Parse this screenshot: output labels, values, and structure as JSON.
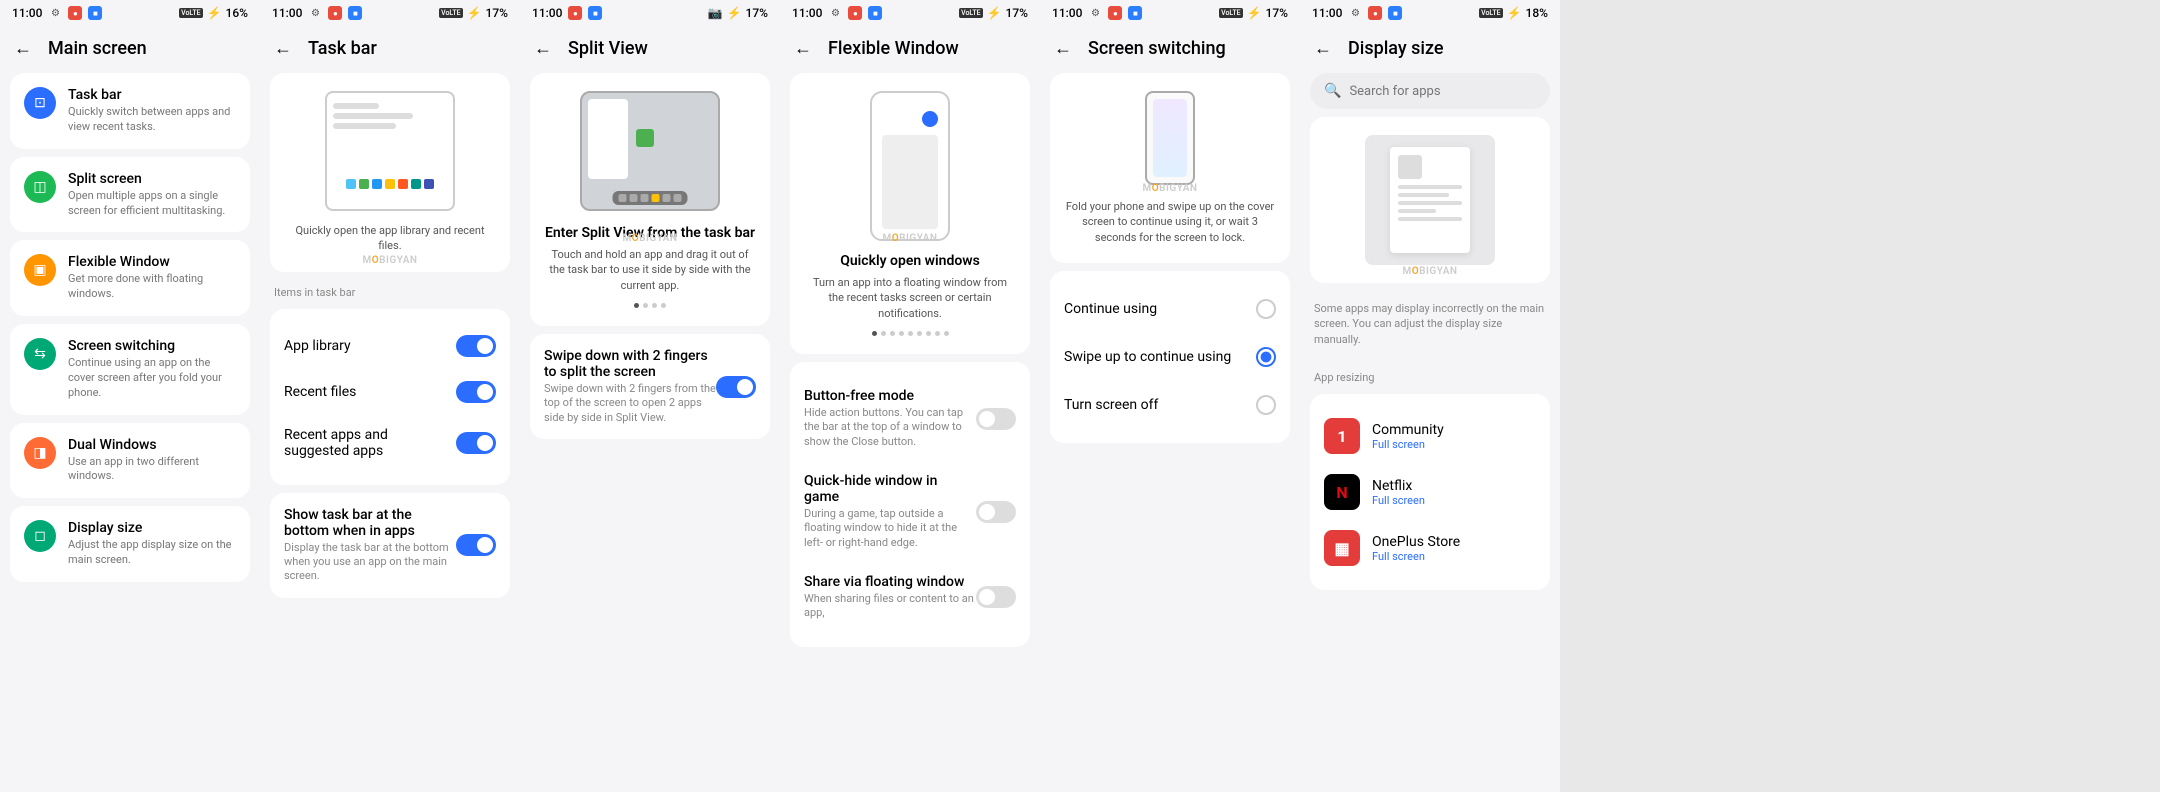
{
  "status": {
    "time": "11:00",
    "battery1": "16%",
    "battery2": "17%",
    "battery3": "18%"
  },
  "watermark": "MOBIGYAN",
  "s1": {
    "title": "Main screen",
    "items": [
      {
        "title": "Task bar",
        "desc": "Quickly switch between apps and view recent tasks."
      },
      {
        "title": "Split screen",
        "desc": "Open multiple apps on a single screen for efficient multitasking."
      },
      {
        "title": "Flexible Window",
        "desc": "Get more done with floating windows."
      },
      {
        "title": "Screen switching",
        "desc": "Continue using an app on the cover screen after you fold your phone."
      },
      {
        "title": "Dual Windows",
        "desc": "Use an app in two different windows."
      },
      {
        "title": "Display size",
        "desc": "Adjust the app display size on the main screen."
      }
    ]
  },
  "s2": {
    "title": "Task bar",
    "caption": "Quickly open the app library and recent files.",
    "section": "Items in task bar",
    "toggles": [
      {
        "label": "App library"
      },
      {
        "label": "Recent files"
      },
      {
        "label": "Recent apps and suggested apps"
      }
    ],
    "bottom": {
      "label": "Show task bar at the bottom when in apps",
      "desc": "Display the task bar at the bottom when you use an app on the main screen."
    }
  },
  "s3": {
    "title": "Split View",
    "il_title": "Enter Split View from the task bar",
    "il_desc": "Touch and hold an app and drag it out of the task bar to use it side by side with the current app.",
    "toggle": {
      "label": "Swipe down with 2 fingers to split the screen",
      "desc": "Swipe down with 2 fingers from the top of the screen to open 2 apps side by side in Split View."
    }
  },
  "s4": {
    "title": "Flexible Window",
    "il_title": "Quickly open windows",
    "il_desc": "Turn an app into a floating window from the recent tasks screen or certain notifications.",
    "opts": [
      {
        "label": "Button-free mode",
        "desc": "Hide action buttons. You can tap the bar at the top of a window to show the Close button."
      },
      {
        "label": "Quick-hide window in game",
        "desc": "During a game, tap outside a floating window to hide it at the left- or right-hand edge."
      },
      {
        "label": "Share via floating window",
        "desc": "When sharing files or content to an app,"
      }
    ]
  },
  "s5": {
    "title": "Screen switching",
    "desc": "Fold your phone and swipe up on the cover screen to continue using it, or wait 3 seconds for the screen to lock.",
    "radios": [
      {
        "label": "Continue using",
        "on": false
      },
      {
        "label": "Swipe up to continue using",
        "on": true
      },
      {
        "label": "Turn screen off",
        "on": false
      }
    ]
  },
  "s6": {
    "title": "Display size",
    "search_placeholder": "Search for apps",
    "info": "Some apps may display incorrectly on the main screen. You can adjust the display size manually.",
    "section": "App resizing",
    "apps": [
      {
        "name": "Community",
        "sub": "Full screen",
        "color": "#e43b3b",
        "letter": "1"
      },
      {
        "name": "Netflix",
        "sub": "Full screen",
        "color": "#000",
        "letter": "N"
      },
      {
        "name": "OnePlus Store",
        "sub": "Full screen",
        "color": "#e43b3b",
        "letter": "▦"
      }
    ]
  }
}
